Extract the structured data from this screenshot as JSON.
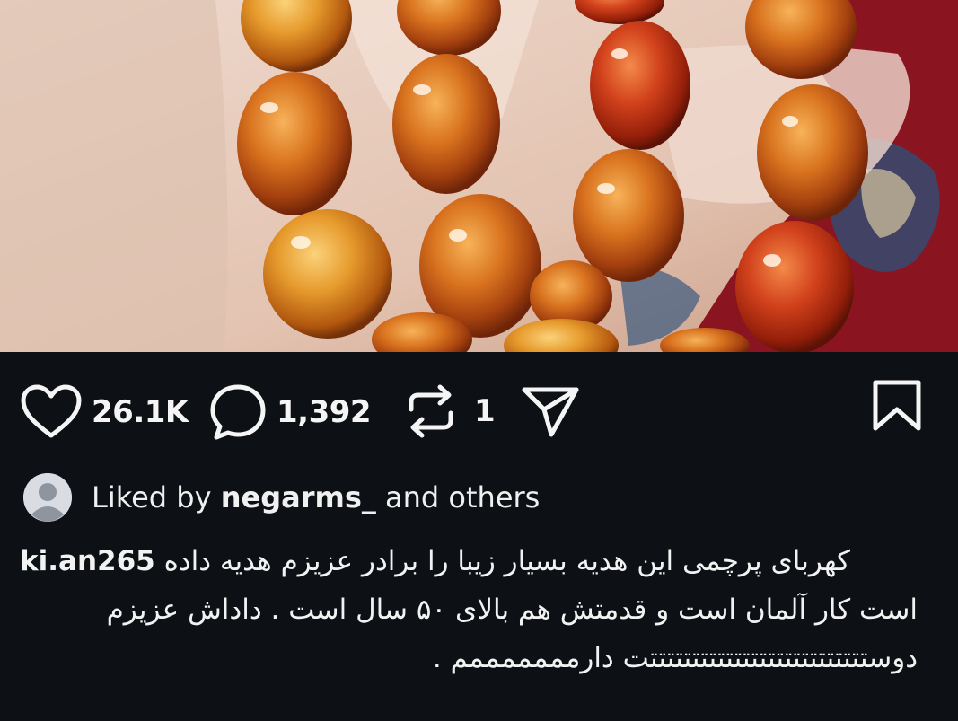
{
  "post": {
    "image_description_icon": "amber-prayer-beads-photo"
  },
  "actions": {
    "likes": "26.1K",
    "comments": "1,392",
    "reposts": "1"
  },
  "liked_by": {
    "prefix": "Liked by",
    "user": "negarms_",
    "suffix": "and others"
  },
  "caption": {
    "username": "ki.an265",
    "line1": "کهربای پرچمی این هدیه بسیار زیبا را برادر عزیزم هدیه داده",
    "line2": "است کار آلمان است و  قدمتش هم بالای ۵۰ سال است . داداش عزیزم",
    "line3": "دوستتتتتتتتتتتتتتتتتتتتتتتتتتت دارمممممممم ."
  },
  "colors": {
    "background": "#0d1014",
    "text": "#f5f5f5"
  }
}
